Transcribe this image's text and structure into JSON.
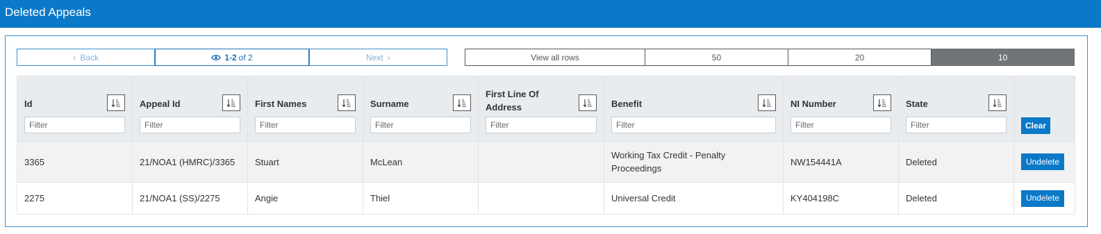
{
  "header": {
    "title": "Deleted Appeals"
  },
  "pager": {
    "back_label": "Back",
    "range": "1-2",
    "of_label": "of 2",
    "next_label": "Next"
  },
  "rows_per_page": {
    "options": [
      "View all rows",
      "50",
      "20",
      "10"
    ],
    "selected": "10"
  },
  "table": {
    "columns": [
      {
        "label": "Id",
        "filter_placeholder": "Filter"
      },
      {
        "label": "Appeal Id",
        "filter_placeholder": "Filter"
      },
      {
        "label": "First Names",
        "filter_placeholder": "Filter"
      },
      {
        "label": "Surname",
        "filter_placeholder": "Filter"
      },
      {
        "label": "First Line Of Address",
        "filter_placeholder": "Filter"
      },
      {
        "label": "Benefit",
        "filter_placeholder": "Filter"
      },
      {
        "label": "NI Number",
        "filter_placeholder": "Filter"
      },
      {
        "label": "State",
        "filter_placeholder": "Filter"
      }
    ],
    "clear_label": "Clear",
    "rows": [
      {
        "id": "3365",
        "appeal_id": "21/NOA1 (HMRC)/3365",
        "first_names": "Stuart",
        "surname": "McLean",
        "address": "",
        "benefit": "Working Tax Credit - Penalty Proceedings",
        "ni_number": "NW154441A",
        "state": "Deleted",
        "action": "Undelete"
      },
      {
        "id": "2275",
        "appeal_id": "21/NOA1 (SS)/2275",
        "first_names": "Angie",
        "surname": "Thiel",
        "address": "",
        "benefit": "Universal Credit",
        "ni_number": "KY404198C",
        "state": "Deleted",
        "action": "Undelete"
      }
    ]
  },
  "colors": {
    "header_bg": "#0b78c8",
    "selected_rows_bg": "#707479",
    "button_bg": "#0b78c8"
  }
}
